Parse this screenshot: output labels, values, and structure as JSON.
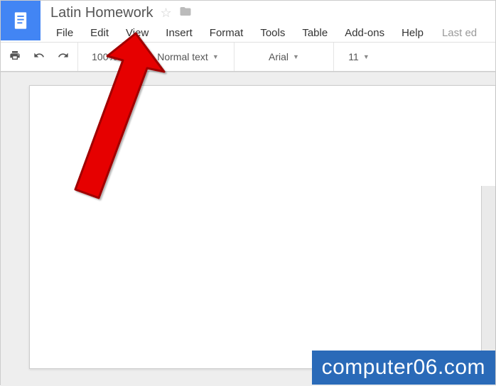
{
  "document": {
    "title": "Latin Homework"
  },
  "menus": {
    "file": "File",
    "edit": "Edit",
    "view": "View",
    "insert": "Insert",
    "format": "Format",
    "tools": "Tools",
    "table": "Table",
    "addons": "Add-ons",
    "help": "Help",
    "last_edit": "Last ed"
  },
  "toolbar": {
    "zoom": "100%",
    "style": "Normal text",
    "font": "Arial",
    "size": "11"
  },
  "watermark": "computer06.com"
}
